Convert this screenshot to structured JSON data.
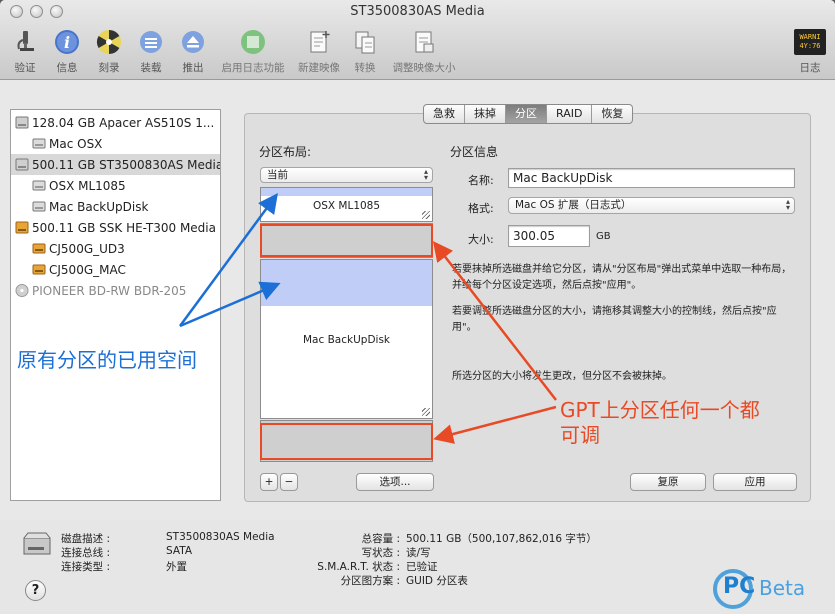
{
  "window": {
    "title": "ST3500830AS Media"
  },
  "toolbar": [
    {
      "label": "验证",
      "icon": "microscope-icon"
    },
    {
      "label": "信息",
      "icon": "info-icon"
    },
    {
      "label": "刻录",
      "icon": "burn-icon"
    },
    {
      "label": "装载",
      "icon": "mount-icon"
    },
    {
      "label": "推出",
      "icon": "eject-icon"
    },
    {
      "label": "启用日志功能",
      "icon": "journaling-icon"
    },
    {
      "label": "新建映像",
      "icon": "new-image-icon"
    },
    {
      "label": "转换",
      "icon": "convert-icon"
    },
    {
      "label": "调整映像大小",
      "icon": "resize-image-icon"
    },
    {
      "label": "日志",
      "icon": "log-icon",
      "badge_line1": "WARNI",
      "badge_line2": "4Y:76"
    }
  ],
  "sidebar": {
    "items": [
      {
        "label": "128.04 GB Apacer AS510S 1...",
        "level": 0,
        "icon": "ssd-icon"
      },
      {
        "label": "Mac OSX",
        "level": 1,
        "icon": "volume-icon"
      },
      {
        "label": "500.11 GB ST3500830AS Media",
        "level": 0,
        "icon": "hdd-icon",
        "selected": true
      },
      {
        "label": "OSX ML1085",
        "level": 1,
        "icon": "volume-icon"
      },
      {
        "label": "Mac BackUpDisk",
        "level": 1,
        "icon": "volume-icon"
      },
      {
        "label": "500.11 GB SSK HE-T300 Media",
        "level": 0,
        "icon": "external-drive-icon"
      },
      {
        "label": "CJ500G_UD3",
        "level": 1,
        "icon": "external-volume-icon"
      },
      {
        "label": "CJ500G_MAC",
        "level": 1,
        "icon": "external-volume-icon"
      },
      {
        "label": "PIONEER BD-RW BDR-205",
        "level": 0,
        "icon": "optical-drive-icon",
        "dim": true
      }
    ]
  },
  "tabs": [
    {
      "label": "急救"
    },
    {
      "label": "抹掉"
    },
    {
      "label": "分区",
      "active": true
    },
    {
      "label": "RAID"
    },
    {
      "label": "恢复"
    }
  ],
  "partition": {
    "layout_heading": "分区布局:",
    "layout_popup": "当前",
    "info_heading": "分区信息",
    "name_label": "名称:",
    "name_value": "Mac BackUpDisk",
    "format_label": "格式:",
    "format_value": "Mac OS 扩展（日志式）",
    "size_label": "大小:",
    "size_value": "300.05",
    "size_unit": "GB",
    "help1": "若要抹掉所选磁盘并给它分区，请从\"分区布局\"弹出式菜单中选取一种布局，并给每个分区设定选项，然后点按\"应用\"。",
    "help2": "若要调整所选磁盘分区的大小，请拖移其调整大小的控制线，然后点按\"应用\"。",
    "help3": "所选分区的大小将发生更改，但分区不会被抹掉。",
    "map": [
      {
        "name": "OSX ML1085",
        "used_fraction": 0.25
      },
      {
        "name": "",
        "free": true
      },
      {
        "name": "Mac BackUpDisk",
        "used_fraction": 0.29
      },
      {
        "name": "",
        "free": true
      }
    ],
    "add_label": "+",
    "remove_label": "−",
    "options_label": "选项...",
    "revert_label": "复原",
    "apply_label": "应用"
  },
  "annotations": {
    "blue_text": "原有分区的已用空间",
    "red_line1": "GPT上分区任何一个都",
    "red_line2": "可调",
    "blue_color": "#1b6fd6",
    "red_color": "#e84a25"
  },
  "disk_info": {
    "desc_label": "磁盘描述 :",
    "desc_value": "ST3500830AS Media",
    "bus_label": "连接总线 :",
    "bus_value": "SATA",
    "type_label": "连接类型 :",
    "type_value": "外置",
    "capacity_label": "总容量 :",
    "capacity_value": "500.11 GB（500,107,862,016 字节）",
    "write_label": "写状态 :",
    "write_value": "读/写",
    "smart_label": "S.M.A.R.T. 状态 :",
    "smart_value": "已验证",
    "scheme_label": "分区图方案 :",
    "scheme_value": "GUID 分区表"
  },
  "help_button": "?",
  "watermark": {
    "prefix": "PC",
    "suffix": "Beta"
  }
}
